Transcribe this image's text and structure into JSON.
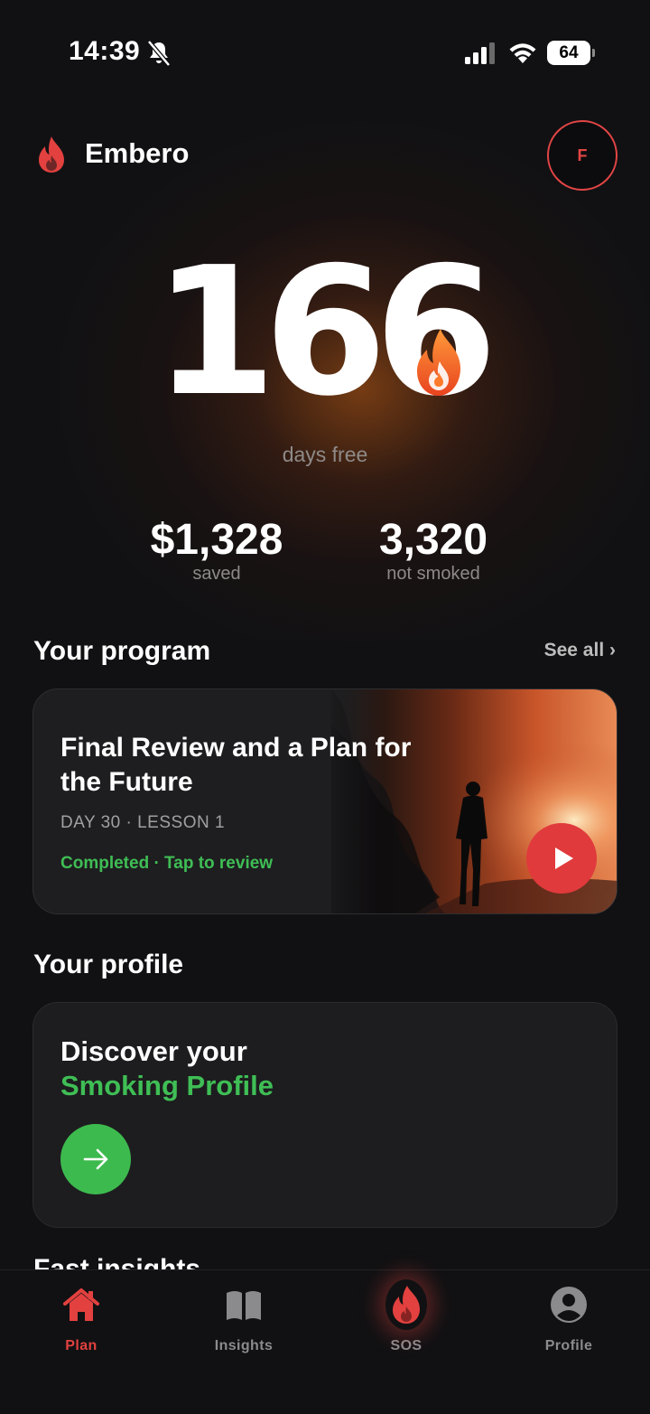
{
  "status_bar": {
    "time": "14:39",
    "battery": "64"
  },
  "brand": {
    "name": "Embero",
    "avatar_initial": "F"
  },
  "hero": {
    "days": "166",
    "days_label": "days free",
    "stats": [
      {
        "value": "$1,328",
        "label": "saved"
      },
      {
        "value": "3,320",
        "label": "not smoked"
      }
    ]
  },
  "program": {
    "title": "Your program",
    "see_all": "See all ›",
    "lesson": {
      "title": "Final Review and a Plan for the Future",
      "meta": "DAY 30 · LESSON 1",
      "status": "Completed · Tap to review"
    }
  },
  "profile": {
    "title": "Your profile",
    "line1": "Discover your",
    "line2": "Smoking Profile"
  },
  "next_section": {
    "title": "Fast insights"
  },
  "tabs": [
    {
      "label": "Plan",
      "icon": "home-icon",
      "active": true
    },
    {
      "label": "Insights",
      "icon": "book-icon",
      "active": false
    },
    {
      "label": "SOS",
      "icon": "flame-icon",
      "active": false
    },
    {
      "label": "Profile",
      "icon": "person-icon",
      "active": false
    }
  ],
  "colors": {
    "accent_red": "#e2413f",
    "accent_green": "#3fbe55",
    "background": "#111113"
  }
}
